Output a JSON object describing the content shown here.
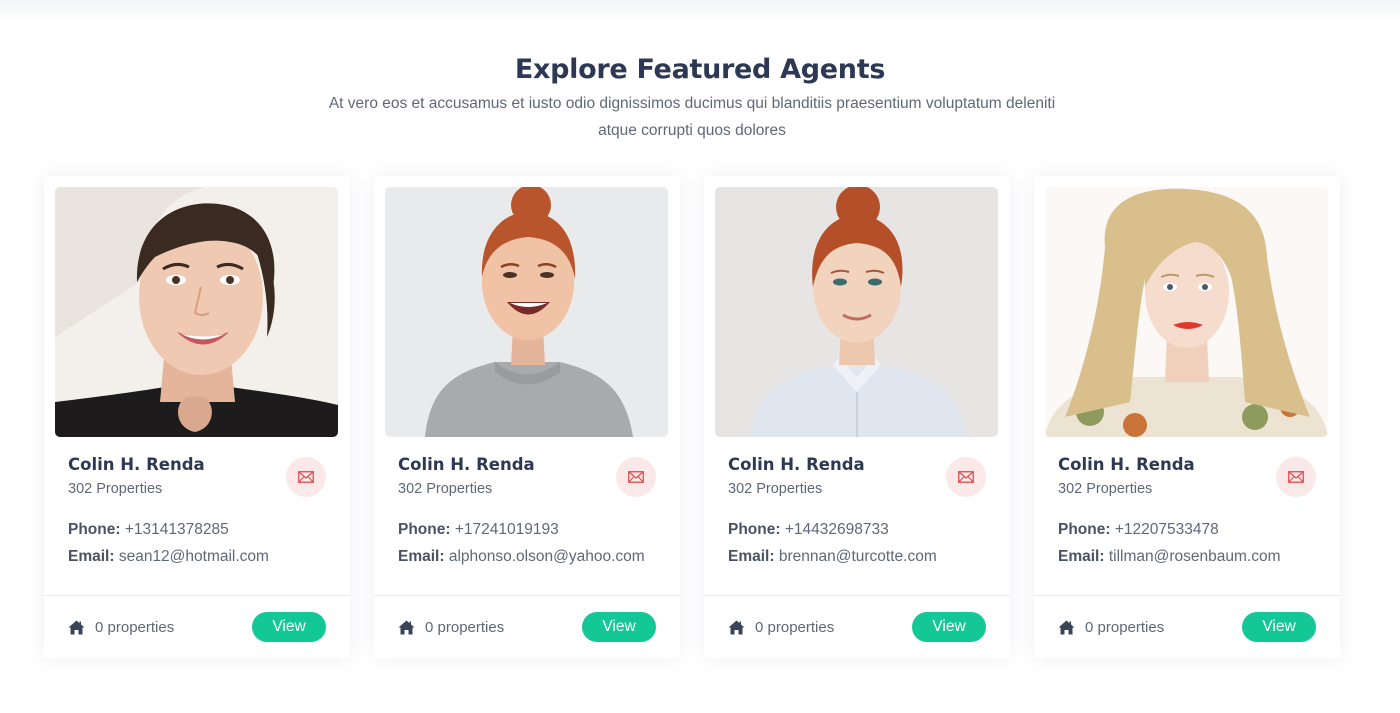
{
  "section": {
    "title": "Explore Featured Agents",
    "description": "At vero eos et accusamus et iusto odio dignissimos ducimus qui blanditiis praesentium voluptatum deleniti atque corrupti quos dolores"
  },
  "labels": {
    "phone": "Phone:",
    "email": "Email:",
    "view": "View"
  },
  "icons": {
    "mail": "envelope-icon",
    "home": "home-icon"
  },
  "colors": {
    "accent": "#13c796",
    "mail_icon": "#e05656",
    "mail_bg": "#fbe9e9",
    "heading": "#2d3954"
  },
  "agents": [
    {
      "name": "Colin H. Renda",
      "properties": "302 Properties",
      "phone": "+13141378285",
      "email": "sean12@hotmail.com",
      "listings": "0 properties"
    },
    {
      "name": "Colin H. Renda",
      "properties": "302 Properties",
      "phone": "+17241019193",
      "email": "alphonso.olson@yahoo.com",
      "listings": "0 properties"
    },
    {
      "name": "Colin H. Renda",
      "properties": "302 Properties",
      "phone": "+14432698733",
      "email": "brennan@turcotte.com",
      "listings": "0 properties"
    },
    {
      "name": "Colin H. Renda",
      "properties": "302 Properties",
      "phone": "+12207533478",
      "email": "tillman@rosenbaum.com",
      "listings": "0 properties"
    }
  ]
}
